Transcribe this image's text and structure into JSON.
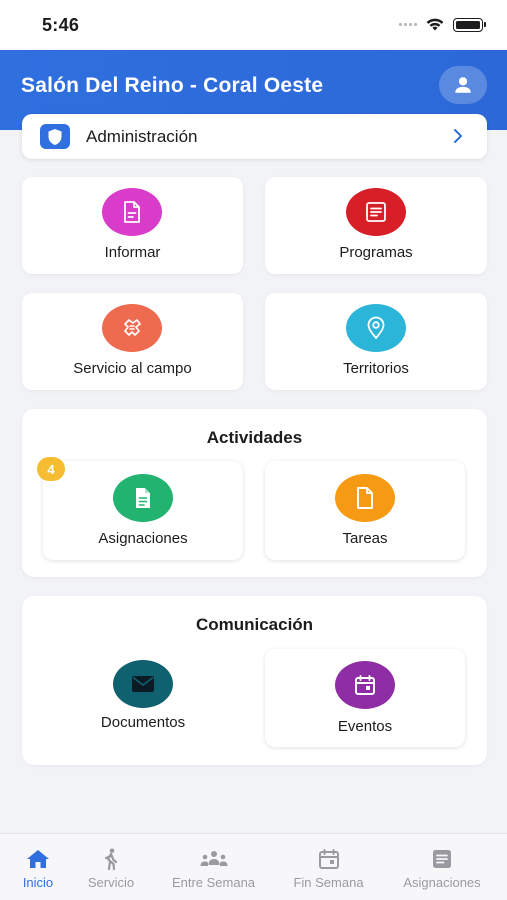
{
  "status_bar": {
    "time": "5:46"
  },
  "header": {
    "title": "Salón Del Reino - Coral Oeste",
    "profile_icon": "person-icon"
  },
  "admin": {
    "label": "Administración",
    "icon": "shield-icon"
  },
  "tiles": [
    {
      "label": "Informar",
      "color": "#d93bcb",
      "icon": "document-icon"
    },
    {
      "label": "Programas",
      "color": "#d61f26",
      "icon": "list-icon"
    },
    {
      "label": "Servicio al campo",
      "color": "#ee6b50",
      "icon": "hands-icon"
    },
    {
      "label": "Territorios",
      "color": "#2ab5d9",
      "icon": "location-pin-icon"
    }
  ],
  "actividades": {
    "title": "Actividades",
    "items": [
      {
        "label": "Asignaciones",
        "color": "#21b36f",
        "icon": "assignment-icon",
        "badge": "4"
      },
      {
        "label": "Tareas",
        "color": "#f59a12",
        "icon": "file-icon"
      }
    ]
  },
  "comunicacion": {
    "title": "Comunicación",
    "items": [
      {
        "label": "Documentos",
        "color": "#0f6170",
        "icon": "mail-icon"
      },
      {
        "label": "Eventos",
        "color": "#8f2ea4",
        "icon": "calendar-icon"
      }
    ]
  },
  "tab_bar": {
    "active_color": "#2f6fde",
    "inactive_color": "#9a9aa1",
    "tabs": [
      {
        "label": "Inicio",
        "icon": "home-icon",
        "active": true
      },
      {
        "label": "Servicio",
        "icon": "walking-person-icon",
        "active": false
      },
      {
        "label": "Entre Semana",
        "icon": "group-icon",
        "active": false
      },
      {
        "label": "Fin Semana",
        "icon": "calendar-icon",
        "active": false
      },
      {
        "label": "Asignaciones",
        "icon": "article-icon",
        "active": false
      }
    ]
  }
}
